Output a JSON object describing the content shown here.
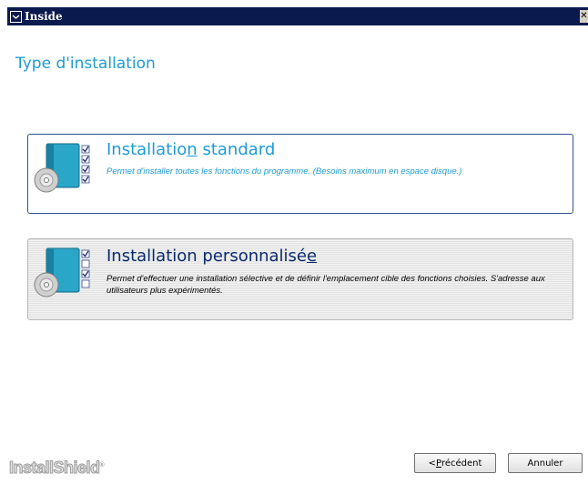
{
  "window": {
    "title": "Inside",
    "close_glyph": "✕",
    "icon": "installer-window-icon"
  },
  "page": {
    "title": "Type d'installation"
  },
  "options": {
    "standard": {
      "title_before": "Installatio",
      "title_mnemonic": "n",
      "title_after": " standard",
      "description": "Permet d'installer toutes les fonctions du programme. (Besoins maximum en espace disque.)",
      "icon": "standard-install-icon",
      "selected": true
    },
    "custom": {
      "title_before": "Installation personnalisé",
      "title_mnemonic": "e",
      "title_after": "",
      "description": "Permet d'effectuer une installation sélective et de définir l'emplacement cible des fonctions choisies. S'adresse aux utilisateurs plus expérimentés.",
      "icon": "custom-install-icon",
      "selected": false
    }
  },
  "footer": {
    "brand": "InstallShield",
    "brand_mark": "®",
    "prev_prefix": "< ",
    "prev_mnemonic": "P",
    "prev_rest": "récédent",
    "cancel_label": "Annuler"
  },
  "colors": {
    "titlebar": "#0b1a4e",
    "accent": "#1d9bd6",
    "option_border": "#33508c"
  }
}
